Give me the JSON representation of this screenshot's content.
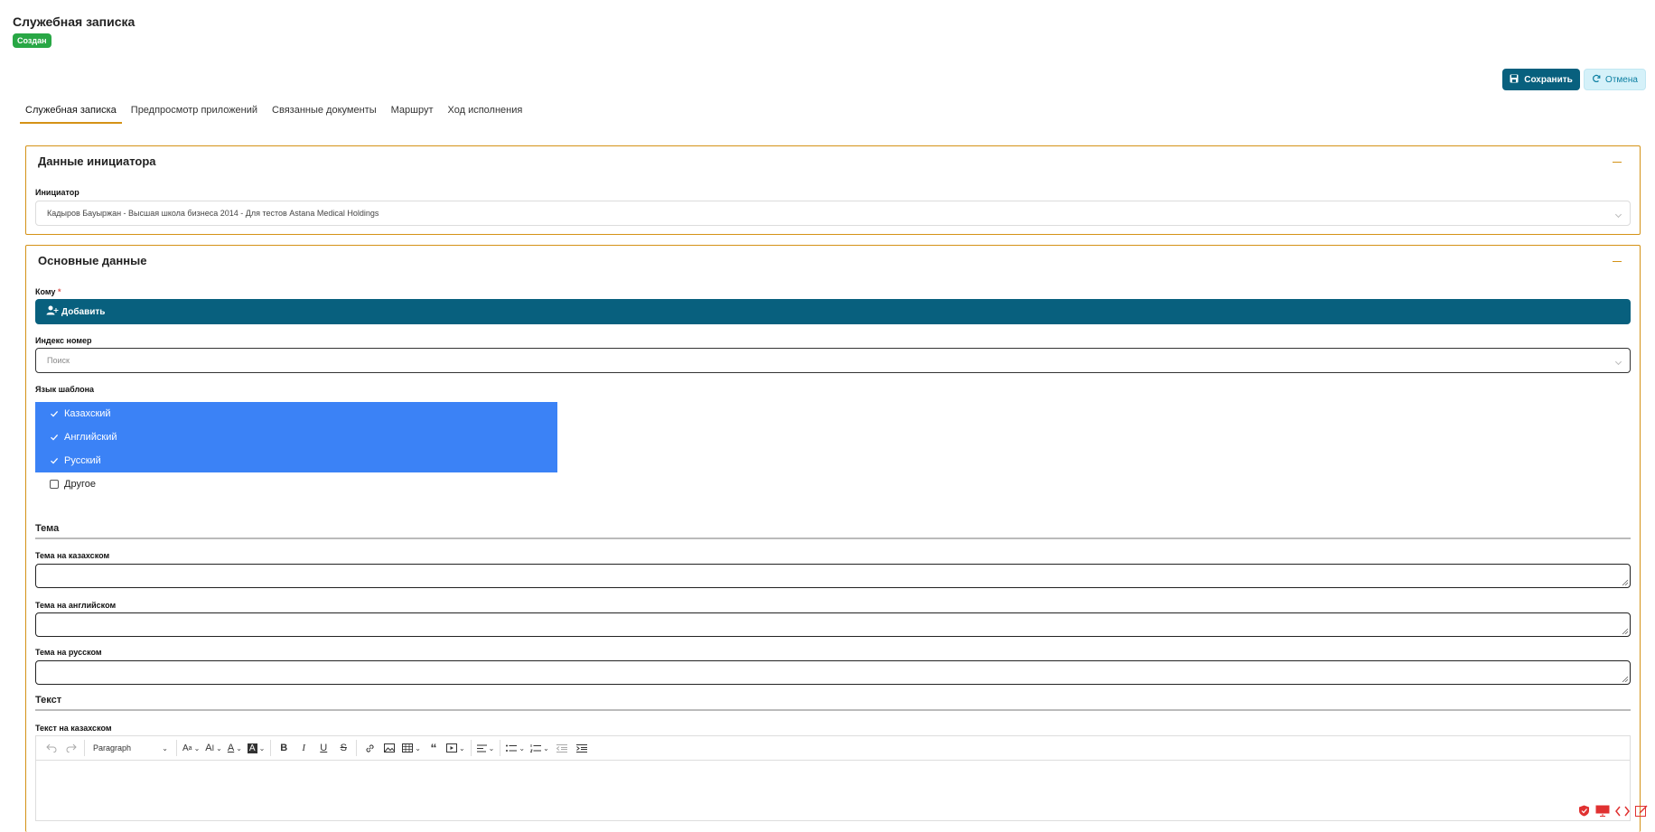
{
  "header": {
    "title": "Служебная записка",
    "status": "Создан"
  },
  "actions": {
    "save_label": "Сохранить",
    "cancel_label": "Отмена"
  },
  "tabs": [
    {
      "label": "Служебная записка",
      "active": true
    },
    {
      "label": "Предпросмотр приложений",
      "active": false
    },
    {
      "label": "Связанные документы",
      "active": false
    },
    {
      "label": "Маршрут",
      "active": false
    },
    {
      "label": "Ход исполнения",
      "active": false
    }
  ],
  "initiator_card": {
    "title": "Данные инициатора",
    "initiator_label": "Инициатор",
    "initiator_value": "Кадыров Бауыржан  - Высшая школа бизнеса 2014 - Для тестов Astana Medical Holdings"
  },
  "main_card": {
    "title": "Основные данные",
    "to_label": "Кому",
    "required_mark": "*",
    "add_label": "Добавить",
    "index_label": "Индекс номер",
    "index_placeholder": "Поиск",
    "lang_label": "Язык шаблона",
    "languages": [
      {
        "label": "Казахский",
        "checked": true
      },
      {
        "label": "Английский",
        "checked": true
      },
      {
        "label": "Русский",
        "checked": true
      },
      {
        "label": "Другое",
        "checked": false
      }
    ],
    "topic_section": "Тема",
    "topic_kz_label": "Тема на казахском",
    "topic_en_label": "Тема на английском",
    "topic_ru_label": "Тема на русском",
    "text_section": "Текст",
    "text_kz_label": "Текст на казахском",
    "editor": {
      "paragraph": "Paragraph"
    }
  },
  "colors": {
    "primary": "#08607e",
    "accent_border": "#d49216",
    "badge_green": "#28a745",
    "selection_blue": "#3b82f6",
    "bottom_icon_red": "#e03131"
  }
}
